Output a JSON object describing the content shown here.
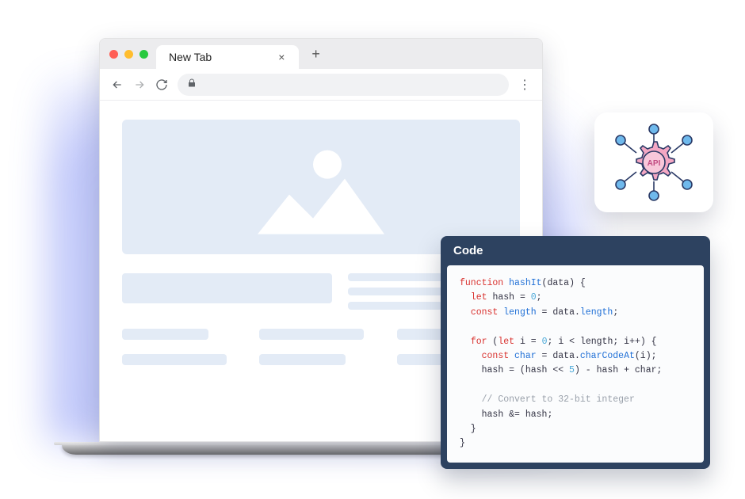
{
  "browser": {
    "tab_title": "New Tab",
    "tab_close": "×",
    "tab_plus": "+"
  },
  "api_badge": {
    "label": "API"
  },
  "code_panel": {
    "title": "Code",
    "tokens": {
      "kw_function": "function",
      "fn_name": "hashIt",
      "param": "data",
      "kw_let": "let",
      "var_hash": "hash",
      "num_zero": "0",
      "kw_const": "const",
      "var_length": "length",
      "prop_length": "length",
      "kw_for": "for",
      "var_i": "i",
      "var_char": "char",
      "fn_charcode": "charCodeAt",
      "num_five": "5",
      "comment": "// Convert to 32-bit integer"
    }
  }
}
